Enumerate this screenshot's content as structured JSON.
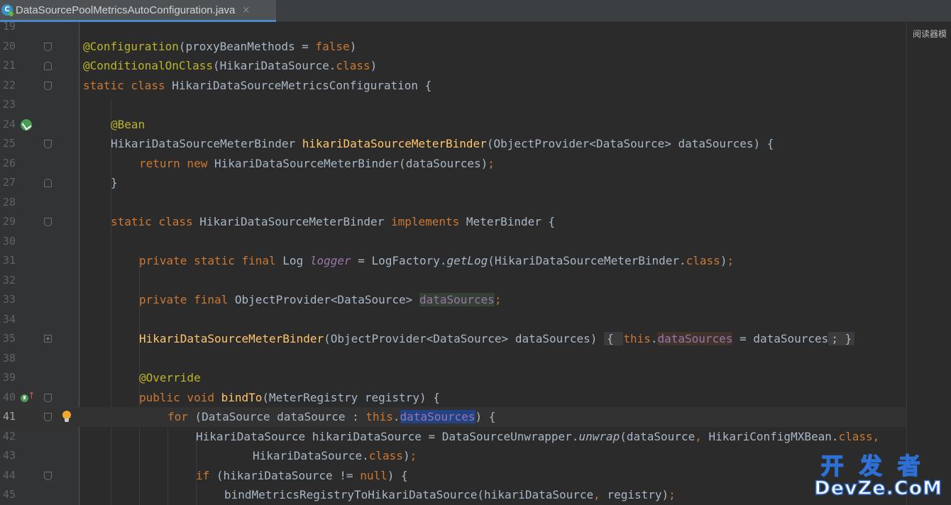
{
  "tab": {
    "file_name": "DataSourcePoolMetricsAutoConfiguration.java",
    "icon": "java-class-icon",
    "close": "×"
  },
  "right_strip": {
    "label": "阅读器模"
  },
  "watermark": {
    "top": "开发者",
    "bottom": "DevZe.CoM"
  },
  "gutter": {
    "line_numbers": [
      "19",
      "20",
      "21",
      "22",
      "23",
      "24",
      "25",
      "26",
      "27",
      "28",
      "29",
      "30",
      "31",
      "32",
      "33",
      "34",
      "35",
      "38",
      "39",
      "40",
      "41",
      "42",
      "43",
      "44",
      "45"
    ],
    "current_line": "41"
  },
  "code": {
    "l20": [
      "@Configuration",
      "(proxyBeanMethods = ",
      "false",
      ")"
    ],
    "l21": [
      "@ConditionalOnClass",
      "(HikariDataSource.",
      "class",
      ")"
    ],
    "l22": [
      "static class ",
      "HikariDataSourceMetricsConfiguration ",
      "{"
    ],
    "l24": [
      "@Bean"
    ],
    "l25": [
      "HikariDataSourceMeterBinder ",
      "hikariDataSourceMeterBinder",
      "(ObjectProvider<DataSource> dataSources) {"
    ],
    "l26": [
      "return new ",
      "HikariDataSourceMeterBinder(dataSources)",
      ";"
    ],
    "l27": [
      "}"
    ],
    "l29": [
      "static class ",
      "HikariDataSourceMeterBinder ",
      "implements ",
      "MeterBinder {"
    ],
    "l31": [
      "private static final ",
      "Log ",
      "logger",
      " = LogFactory.",
      "getLog",
      "(HikariDataSourceMeterBinder.",
      "class",
      ")",
      ";"
    ],
    "l33": [
      "private final ",
      "ObjectProvider<DataSource> ",
      "dataSources",
      ";"
    ],
    "l35": [
      "HikariDataSourceMeterBinder",
      "(ObjectProvider<DataSource> dataSources) ",
      "{ ",
      "this",
      ".",
      "dataSources",
      " = dataSources",
      "; }"
    ],
    "l39": [
      "@Override"
    ],
    "l40": [
      "public void ",
      "bindTo",
      "(MeterRegistry registry) {"
    ],
    "l41": [
      "for ",
      "(DataSource dataSource : ",
      "this",
      ".",
      "dataSources",
      ") {"
    ],
    "l42": [
      "HikariDataSource hikariDataSource = DataSourceUnwrapper.",
      "unwrap",
      "(dataSource",
      ", ",
      "HikariConfigMXBean.",
      "class",
      ","
    ],
    "l43": [
      "HikariDataSource.",
      "class",
      ")",
      ";"
    ],
    "l44": [
      "if ",
      "(hikariDataSource != ",
      "null",
      ") {"
    ],
    "l45": [
      "bindMetricsRegistryToHikariDataSource(hikariDataSource",
      ", ",
      "registry)",
      ";"
    ]
  },
  "colors": {
    "keyword": "#cc7832",
    "annotation": "#bbb529",
    "method_decl": "#ffc66d",
    "field": "#9876aa",
    "plain": "#a9b7c6",
    "background": "#2b2b2b",
    "gutter": "#313335",
    "selection": "#214283"
  }
}
